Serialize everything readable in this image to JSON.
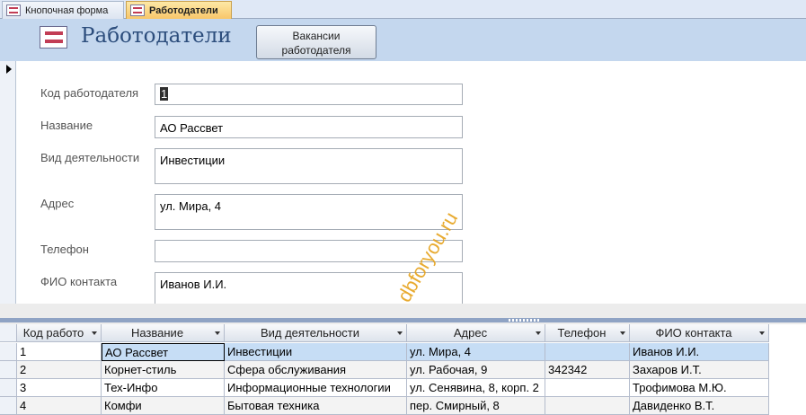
{
  "tabs": [
    {
      "label": "Кнопочная форма",
      "active": false
    },
    {
      "label": "Работодатели",
      "active": true
    }
  ],
  "header": {
    "title": "Работодатели",
    "vacancies_button_line1": "Вакансии",
    "vacancies_button_line2": "работодателя"
  },
  "form": {
    "fields": [
      {
        "label": "Код работодателя",
        "value": "1"
      },
      {
        "label": "Название",
        "value": "АО Рассвет"
      },
      {
        "label": "Вид деятельности",
        "value": "Инвестиции"
      },
      {
        "label": "Адрес",
        "value": "ул. Мира, 4"
      },
      {
        "label": "Телефон",
        "value": ""
      },
      {
        "label": "ФИО контакта",
        "value": "Иванов И.И."
      }
    ],
    "watermark": "dbforyou.ru"
  },
  "datasheet": {
    "columns": [
      "Код работо",
      "Название",
      "Вид деятельности",
      "Адрес",
      "Телефон",
      "ФИО контакта"
    ],
    "rows": [
      [
        "1",
        "АО Рассвет",
        "Инвестиции",
        "ул. Мира, 4",
        "",
        "Иванов И.И."
      ],
      [
        "2",
        "Корнет-стиль",
        "Сфера обслуживания",
        "ул. Рабочая, 9",
        "342342",
        "Захаров И.Т."
      ],
      [
        "3",
        "Тех-Инфо",
        "Информационные технологии",
        "ул. Сенявина, 8, корп. 2",
        "",
        "Трофимова М.Ю."
      ],
      [
        "4",
        "Комфи",
        "Бытовая техника",
        "пер. Смирный, 8",
        "",
        "Давиденко В.Т."
      ]
    ]
  },
  "colors": {
    "header_band": "#c4d7ee",
    "title": "#2c4d7c",
    "active_tab": "#f8c66a",
    "active_row": "#c6ddf5",
    "watermark": "#e6a21b"
  }
}
